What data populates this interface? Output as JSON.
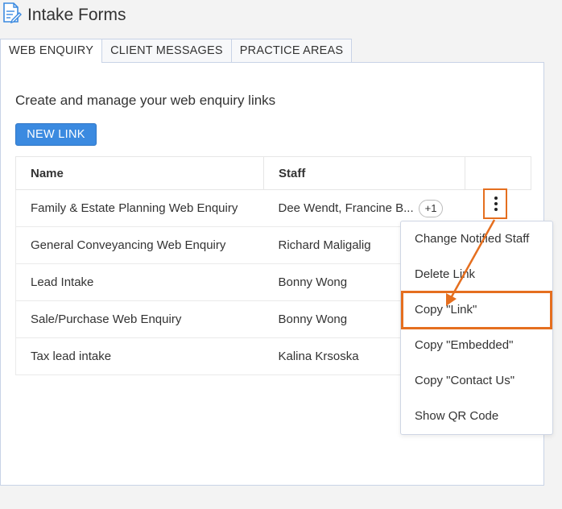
{
  "header": {
    "title": "Intake Forms",
    "logo_icon": "form-edit-icon"
  },
  "tabs": [
    {
      "label": "WEB ENQUIRY",
      "active": true
    },
    {
      "label": "CLIENT MESSAGES",
      "active": false
    },
    {
      "label": "PRACTICE AREAS",
      "active": false
    }
  ],
  "main": {
    "description": "Create and manage your web enquiry links",
    "new_link_label": "NEW LINK",
    "table": {
      "columns": [
        "Name",
        "Staff"
      ],
      "rows": [
        {
          "name": "Family & Estate Planning Web Enquiry",
          "staff": "Dee Wendt, Francine B...",
          "extra": "+1"
        },
        {
          "name": "General Conveyancing Web Enquiry",
          "staff": "Richard Maligalig"
        },
        {
          "name": "Lead Intake",
          "staff": "Bonny Wong"
        },
        {
          "name": "Sale/Purchase Web Enquiry",
          "staff": "Bonny Wong"
        },
        {
          "name": "Tax lead intake",
          "staff": "Kalina Krsoska"
        }
      ]
    }
  },
  "context_menu": {
    "trigger_icon": "more-vertical-icon",
    "items": [
      "Change Notified Staff",
      "Delete Link",
      "Copy \"Link\"",
      "Copy \"Embedded\"",
      "Copy \"Contact Us\"",
      "Show QR Code"
    ],
    "highlighted_item_index": 2
  },
  "colors": {
    "accent": "#3b8ae0",
    "annotation": "#e56f1f",
    "border": "#c8d3e6"
  }
}
